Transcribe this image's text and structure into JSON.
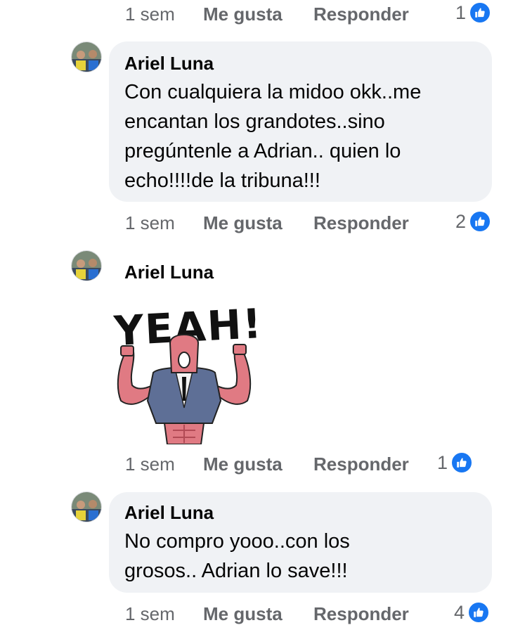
{
  "colors": {
    "like_blue": "#1877f2",
    "bubble_bg": "#f0f2f5",
    "meta_gray": "#65676b"
  },
  "top_actions": {
    "time": "1 sem",
    "like": "Me gusta",
    "reply": "Responder",
    "count": "1",
    "icon": "like-icon"
  },
  "comments": [
    {
      "author": "Ariel Luna",
      "text": "Con cualquiera la midoo okk..me\nencantan los grandotes..sino\npregúntenle a Adrian.. quien lo\necho!!!!de la tribuna!!!",
      "time": "1 sem",
      "like": "Me gusta",
      "reply": "Responder",
      "count": "2",
      "icon": "like-icon"
    },
    {
      "author": "Ariel Luna",
      "sticker_text": "YEAH!",
      "time": "1 sem",
      "like": "Me gusta",
      "reply": "Responder",
      "count": "1",
      "icon": "like-icon"
    },
    {
      "author": "Ariel Luna",
      "text": "No compro yooo..con los\ngrosos.. Adrian lo save!!!",
      "time": "1 sem",
      "like": "Me gusta",
      "reply": "Responder",
      "count": "4",
      "icon": "like-icon"
    }
  ]
}
